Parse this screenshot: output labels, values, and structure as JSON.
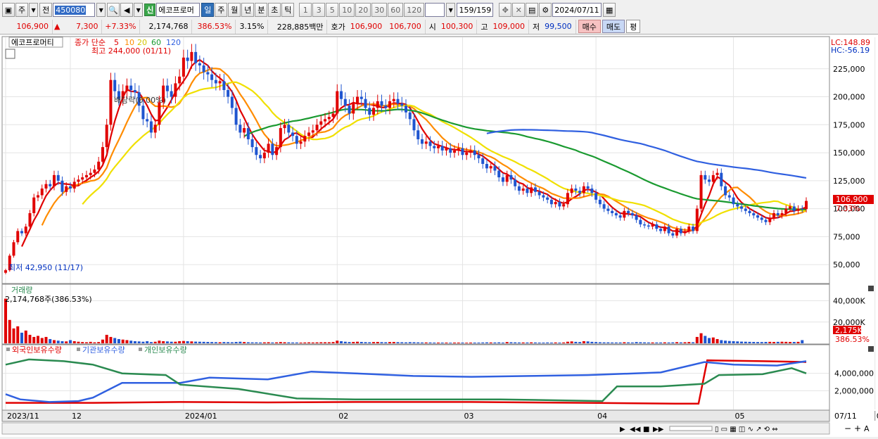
{
  "toolbar": {
    "period_main": "주",
    "prev_label": "전",
    "code": "450080",
    "market_badge": "신",
    "stock_name": "에코프로머",
    "periods": [
      "일",
      "주",
      "월",
      "년",
      "분",
      "초",
      "틱"
    ],
    "selected_period": "일",
    "intervals": [
      "1",
      "3",
      "5",
      "10",
      "20",
      "30",
      "60",
      "120"
    ],
    "count_value": "159",
    "count_total": "/159",
    "date": "2024/07/11"
  },
  "quote": {
    "price": "106,900",
    "arrow": "▲",
    "change": "7,300",
    "change_pct": "+7.33%",
    "volume": "2,174,768",
    "volume_pct": "386.53%",
    "turnover": "3.15%",
    "amount": "228,885백만",
    "bid_label": "호가",
    "ask_price": "106,900",
    "bid_price": "106,700",
    "open_label": "시",
    "open": "100,300",
    "high_label": "고",
    "high": "109,000",
    "low_label": "저",
    "low": "99,500",
    "buy": "매수",
    "sell": "매도",
    "avg": "평"
  },
  "chart_data": {
    "type": "candlestick",
    "title": "에코프로머티",
    "ma_label": "종가 단순",
    "ma_periods": [
      "5",
      "10",
      "20",
      "60",
      "120"
    ],
    "ma_colors": [
      "#e00000",
      "#ff8c00",
      "#f0e000",
      "#1a9a30",
      "#3060e0"
    ],
    "high_annotation": "최고 244,000 (01/11)",
    "low_annotation": "최저 42,950 (11/17)",
    "split_annotation": "배당락(0.00%)",
    "lc_label": "LC:148.89",
    "hc_label": "HC:-56.19",
    "price_ticks": [
      "225,000",
      "200,000",
      "175,000",
      "150,000",
      "125,000",
      "100,000",
      "75,000",
      "50,000"
    ],
    "price_tick_values": [
      225000,
      200000,
      175000,
      150000,
      125000,
      100000,
      75000,
      50000
    ],
    "ylim": [
      35000,
      250000
    ],
    "last_price_label": "106,900",
    "last_change_label": "7.33%",
    "x_labels": [
      "2023/11",
      "12",
      "2024/01",
      "02",
      "03",
      "04",
      "05",
      "06",
      "07"
    ],
    "x_label_index": [
      0,
      16,
      44,
      82,
      113,
      146,
      180,
      215,
      249
    ],
    "right_date": "07/11",
    "closes": [
      45000,
      58000,
      70000,
      80000,
      78000,
      84000,
      96000,
      110000,
      112000,
      118000,
      122000,
      120000,
      130000,
      125000,
      115000,
      120000,
      118000,
      124000,
      126000,
      128000,
      130000,
      132000,
      135000,
      142000,
      155000,
      175000,
      215000,
      205000,
      198000,
      205000,
      210000,
      206000,
      204000,
      192000,
      180000,
      178000,
      168000,
      175000,
      195000,
      210000,
      205000,
      200000,
      212000,
      218000,
      235000,
      232000,
      240000,
      230000,
      228000,
      222000,
      220000,
      215000,
      212000,
      214000,
      206000,
      200000,
      190000,
      175000,
      168000,
      172000,
      162000,
      155000,
      148000,
      145000,
      150000,
      158000,
      148000,
      155000,
      172000,
      175000,
      168000,
      165000,
      158000,
      160000,
      165000,
      168000,
      170000,
      175000,
      178000,
      180000,
      182000,
      185000,
      205000,
      198000,
      192000,
      185000,
      194000,
      200000,
      198000,
      190000,
      184000,
      190000,
      196000,
      192000,
      190000,
      196000,
      198000,
      194000,
      192000,
      186000,
      180000,
      170000,
      162000,
      158000,
      160000,
      156000,
      154000,
      156000,
      152000,
      154000,
      150000,
      152000,
      154000,
      148000,
      150000,
      152000,
      148000,
      145000,
      140000,
      136000,
      138000,
      134000,
      128000,
      124000,
      130000,
      126000,
      120000,
      116000,
      118000,
      114000,
      119000,
      115000,
      112000,
      110000,
      108000,
      104000,
      106000,
      102000,
      104000,
      114000,
      118000,
      116000,
      114000,
      120000,
      118000,
      114000,
      108000,
      104000,
      100000,
      98000,
      96000,
      94000,
      92000,
      98000,
      96000,
      94000,
      90000,
      86000,
      85000,
      84000,
      86000,
      82000,
      80000,
      84000,
      78000,
      76000,
      82000,
      78000,
      80000,
      84000,
      80000,
      100000,
      130000,
      126000,
      124000,
      130000,
      132000,
      120000,
      112000,
      110000,
      104000,
      102000,
      100000,
      98000,
      96000,
      94000,
      92000,
      90000,
      88000,
      92000,
      96000,
      94000,
      96000,
      100000,
      102000,
      98000,
      100000,
      99600,
      106900
    ],
    "volume_label": "거래량",
    "volume_value_label": "2,174,768주(386.53%)",
    "volume_ticks": [
      "40,000K",
      "20,000K"
    ],
    "volume_tick_values": [
      40000,
      20000
    ],
    "volume_last_label": "2,175K",
    "volume_last_pct": "386.53%",
    "volumes": [
      42000,
      22000,
      14000,
      16000,
      10000,
      12000,
      8000,
      6000,
      7000,
      5000,
      6000,
      4000,
      3000,
      2500,
      2000,
      1800,
      3000,
      2000,
      1500,
      1200,
      1000,
      1400,
      900,
      1200,
      3500,
      8000,
      6000,
      5000,
      4000,
      3500,
      3000,
      2500,
      2000,
      1800,
      1500,
      2000,
      1200,
      1500,
      2500,
      2000,
      1800,
      1500,
      1500,
      2000,
      2200,
      2000,
      1800,
      1600,
      1500,
      1400,
      1300,
      1200,
      1100,
      1000,
      1200,
      1100,
      1000,
      1300,
      1500,
      1200,
      1000,
      900,
      900,
      800,
      900,
      1000,
      800,
      900,
      1200,
      1000,
      900,
      800,
      800,
      700,
      800,
      900,
      800,
      900,
      1000,
      1000,
      1000,
      1200,
      2500,
      2000,
      1500,
      1200,
      1300,
      1500,
      1300,
      1100,
      1000,
      1200,
      1300,
      1100,
      1000,
      1200,
      1300,
      1100,
      1000,
      900,
      1100,
      1000,
      900,
      800,
      800,
      800,
      700,
      700,
      700,
      700,
      600,
      700,
      700,
      700,
      600,
      700,
      700,
      700,
      800,
      900,
      800,
      800,
      900,
      700,
      1200,
      1000,
      900,
      800,
      800,
      800,
      900,
      800,
      700,
      700,
      800,
      700,
      800,
      700,
      800,
      1500,
      1800,
      1400,
      1200,
      2000,
      1800,
      1400,
      1200,
      1000,
      900,
      900,
      800,
      800,
      800,
      1000,
      900,
      800,
      1200,
      1000,
      900,
      800,
      800,
      800,
      800,
      900,
      800,
      900,
      1100,
      900,
      1000,
      1200,
      1000,
      6000,
      9500,
      7000,
      5000,
      5500,
      4000,
      3000,
      2500,
      2200,
      2000,
      1800,
      1600,
      1500,
      1400,
      1300,
      1200,
      1200,
      1300,
      1400,
      1300,
      1400,
      1500,
      1400,
      1300,
      1300,
      1400,
      3000
    ],
    "volume_max": 45000,
    "holdings_labels": [
      "외국인보유수량",
      "기관보유수량",
      "개인보유수량"
    ],
    "holdings_colors": [
      "#e00000",
      "#3060e0",
      "#2a8a50"
    ],
    "holdings_ticks": [
      "4,000,000",
      "2,000,000"
    ],
    "holdings_tick_values": [
      4000000,
      2000000
    ],
    "holdings_max": 6000000,
    "foreign": [
      [
        0,
        600000
      ],
      [
        30,
        600000
      ],
      [
        60,
        700000
      ],
      [
        90,
        650000
      ],
      [
        120,
        700000
      ],
      [
        160,
        700000
      ],
      [
        200,
        600000
      ],
      [
        230,
        500000
      ],
      [
        238,
        500000
      ],
      [
        241,
        5500000
      ],
      [
        260,
        5400000
      ],
      [
        275,
        5300000
      ]
    ],
    "institution": [
      [
        0,
        1600000
      ],
      [
        5,
        1000000
      ],
      [
        15,
        700000
      ],
      [
        25,
        800000
      ],
      [
        30,
        1200000
      ],
      [
        40,
        2900000
      ],
      [
        60,
        2900000
      ],
      [
        70,
        3500000
      ],
      [
        90,
        3300000
      ],
      [
        105,
        4200000
      ],
      [
        120,
        4000000
      ],
      [
        140,
        3700000
      ],
      [
        160,
        3600000
      ],
      [
        180,
        3700000
      ],
      [
        200,
        3800000
      ],
      [
        225,
        4100000
      ],
      [
        240,
        5300000
      ],
      [
        250,
        5000000
      ],
      [
        265,
        4900000
      ],
      [
        275,
        5400000
      ]
    ],
    "individual": [
      [
        0,
        5000000
      ],
      [
        8,
        5600000
      ],
      [
        20,
        5400000
      ],
      [
        30,
        5000000
      ],
      [
        40,
        4000000
      ],
      [
        55,
        3800000
      ],
      [
        60,
        2700000
      ],
      [
        80,
        2200000
      ],
      [
        100,
        1100000
      ],
      [
        120,
        1000000
      ],
      [
        140,
        1000000
      ],
      [
        170,
        1000000
      ],
      [
        205,
        800000
      ],
      [
        210,
        2500000
      ],
      [
        225,
        2500000
      ],
      [
        240,
        2800000
      ],
      [
        245,
        3800000
      ],
      [
        260,
        3900000
      ],
      [
        270,
        4600000
      ],
      [
        275,
        4000000
      ]
    ]
  }
}
